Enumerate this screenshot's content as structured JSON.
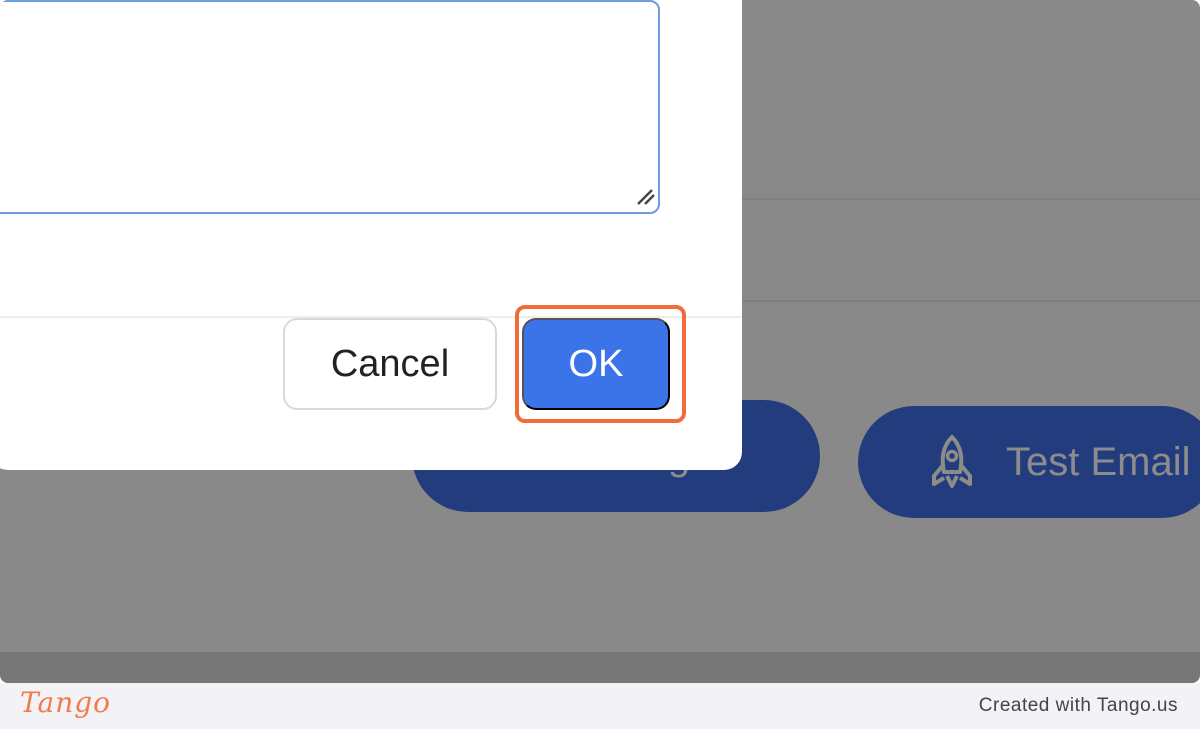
{
  "background_app": {
    "save_button_label": "Save Changes",
    "test_button_label": "Test Email",
    "test_button_icon": "rocket-icon",
    "accent_color": "#3f6ee6"
  },
  "dialog": {
    "textarea_value": "",
    "cancel_label": "Cancel",
    "ok_label": "OK",
    "ok_color": "#3b73e8"
  },
  "highlight_color": "#f26b3a",
  "footer": {
    "logo_text": "Tango",
    "credit_text": "Created with Tango.us"
  }
}
